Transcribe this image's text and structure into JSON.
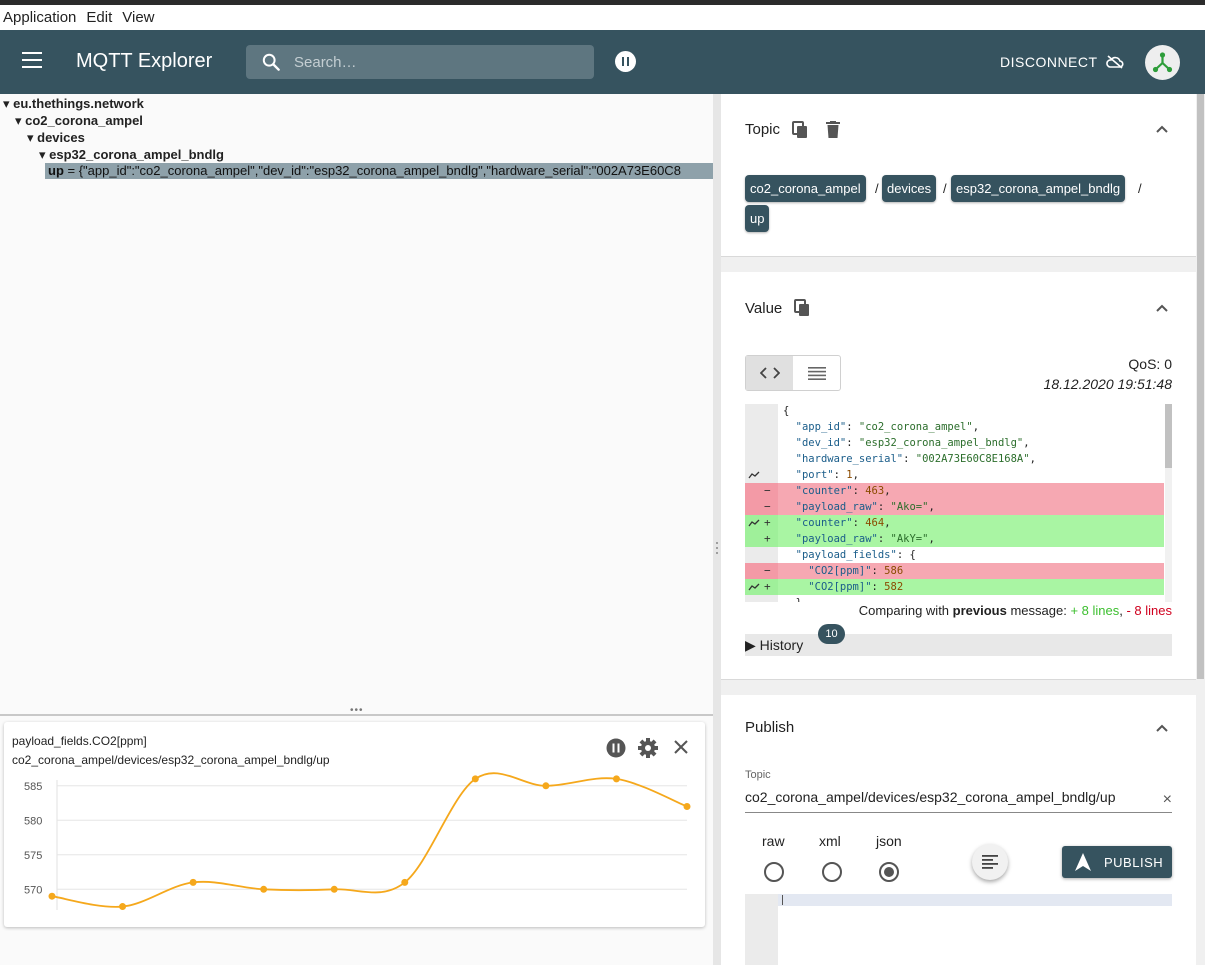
{
  "menu": [
    "Application",
    "Edit",
    "View"
  ],
  "appbar": {
    "title": "MQTT Explorer",
    "search_placeholder": "Search…",
    "disconnect_label": "DISCONNECT"
  },
  "tree": {
    "root": "eu.thethings.network",
    "level1": "co2_corona_ampel",
    "level2": "devices",
    "level3": "esp32_corona_ampel_bndlg",
    "leaf_key": "up",
    "leaf_value": " = {\"app_id\":\"co2_corona_ampel\",\"dev_id\":\"esp32_corona_ampel_bndlg\",\"hardware_serial\":\"002A73E60C8"
  },
  "chart": {
    "title": "payload_fields.CO2[ppm]",
    "topic": "co2_corona_ampel/devices/esp32_corona_ampel_bndlg/up"
  },
  "chart_data": {
    "type": "line",
    "title": "payload_fields.CO2[ppm]",
    "subtitle": "co2_corona_ampel/devices/esp32_corona_ampel_bndlg/up",
    "xlabel": "",
    "ylabel": "",
    "yticks": [
      570,
      575,
      580,
      585
    ],
    "ylim": [
      567,
      587
    ],
    "grid": true,
    "color": "#f5a81c",
    "series": [
      {
        "values": [
          569,
          567.5,
          571,
          570,
          570,
          571,
          586,
          585,
          586,
          582
        ]
      }
    ]
  },
  "topic_panel": {
    "title": "Topic",
    "chips": [
      "co2_corona_ampel",
      "devices",
      "esp32_corona_ampel_bndlg",
      "up"
    ],
    "separator": "/"
  },
  "value_panel": {
    "title": "Value",
    "qos": "QoS: 0",
    "timestamp": "18.12.2020 19:51:48",
    "diff_lines": [
      {
        "type": "ctx",
        "trend": false,
        "sign": "",
        "indent": "",
        "key": "",
        "value": "{"
      },
      {
        "type": "ctx",
        "trend": false,
        "sign": "",
        "indent": "  ",
        "key": "\"app_id\"",
        "value": "\"co2_corona_ampel\"",
        "vt": "s",
        "tail": ","
      },
      {
        "type": "ctx",
        "trend": false,
        "sign": "",
        "indent": "  ",
        "key": "\"dev_id\"",
        "value": "\"esp32_corona_ampel_bndlg\"",
        "vt": "s",
        "tail": ","
      },
      {
        "type": "ctx",
        "trend": false,
        "sign": "",
        "indent": "  ",
        "key": "\"hardware_serial\"",
        "value": "\"002A73E60C8E168A\"",
        "vt": "s",
        "tail": ","
      },
      {
        "type": "ctx",
        "trend": true,
        "sign": "",
        "indent": "  ",
        "key": "\"port\"",
        "value": "1",
        "vt": "n",
        "tail": ","
      },
      {
        "type": "removed",
        "trend": false,
        "sign": "−",
        "indent": "  ",
        "key": "\"counter\"",
        "value": "463",
        "vt": "n",
        "tail": ","
      },
      {
        "type": "removed",
        "trend": false,
        "sign": "−",
        "indent": "  ",
        "key": "\"payload_raw\"",
        "value": "\"Ako=\"",
        "vt": "s",
        "tail": ","
      },
      {
        "type": "added",
        "trend": true,
        "sign": "+",
        "indent": "  ",
        "key": "\"counter\"",
        "value": "464",
        "vt": "n",
        "tail": ","
      },
      {
        "type": "added",
        "trend": false,
        "sign": "+",
        "indent": "  ",
        "key": "\"payload_raw\"",
        "value": "\"AkY=\"",
        "vt": "s",
        "tail": ","
      },
      {
        "type": "ctx",
        "trend": false,
        "sign": "",
        "indent": "  ",
        "key": "\"payload_fields\"",
        "value": "{",
        "vt": "p",
        "tail": ""
      },
      {
        "type": "removed",
        "trend": false,
        "sign": "−",
        "indent": "    ",
        "key": "\"CO2[ppm]\"",
        "value": "586",
        "vt": "n",
        "tail": ""
      },
      {
        "type": "added",
        "trend": true,
        "sign": "+",
        "indent": "    ",
        "key": "\"CO2[ppm]\"",
        "value": "582",
        "vt": "n",
        "tail": ""
      },
      {
        "type": "ctx",
        "trend": false,
        "sign": "",
        "indent": "  ",
        "key": "",
        "value": "}"
      }
    ],
    "compare_prefix": "Comparing with ",
    "compare_bold": "previous",
    "compare_mid": " message: ",
    "compare_added": "+ 8 lines",
    "compare_sep": ", ",
    "compare_removed": "- 8 lines",
    "history_label": "▶ History",
    "history_count": "10"
  },
  "publish_panel": {
    "title": "Publish",
    "topic_label": "Topic",
    "topic_value": "co2_corona_ampel/devices/esp32_corona_ampel_bndlg/up",
    "clear_icon": "×",
    "formats": [
      "raw",
      "xml",
      "json"
    ],
    "selected_format": "json",
    "publish_label": "PUBLISH"
  },
  "colors": {
    "primary": "#36535f",
    "chart_line": "#f5a81c",
    "diff_removed": "#f6a8b2",
    "diff_added": "#a9f5a3"
  }
}
